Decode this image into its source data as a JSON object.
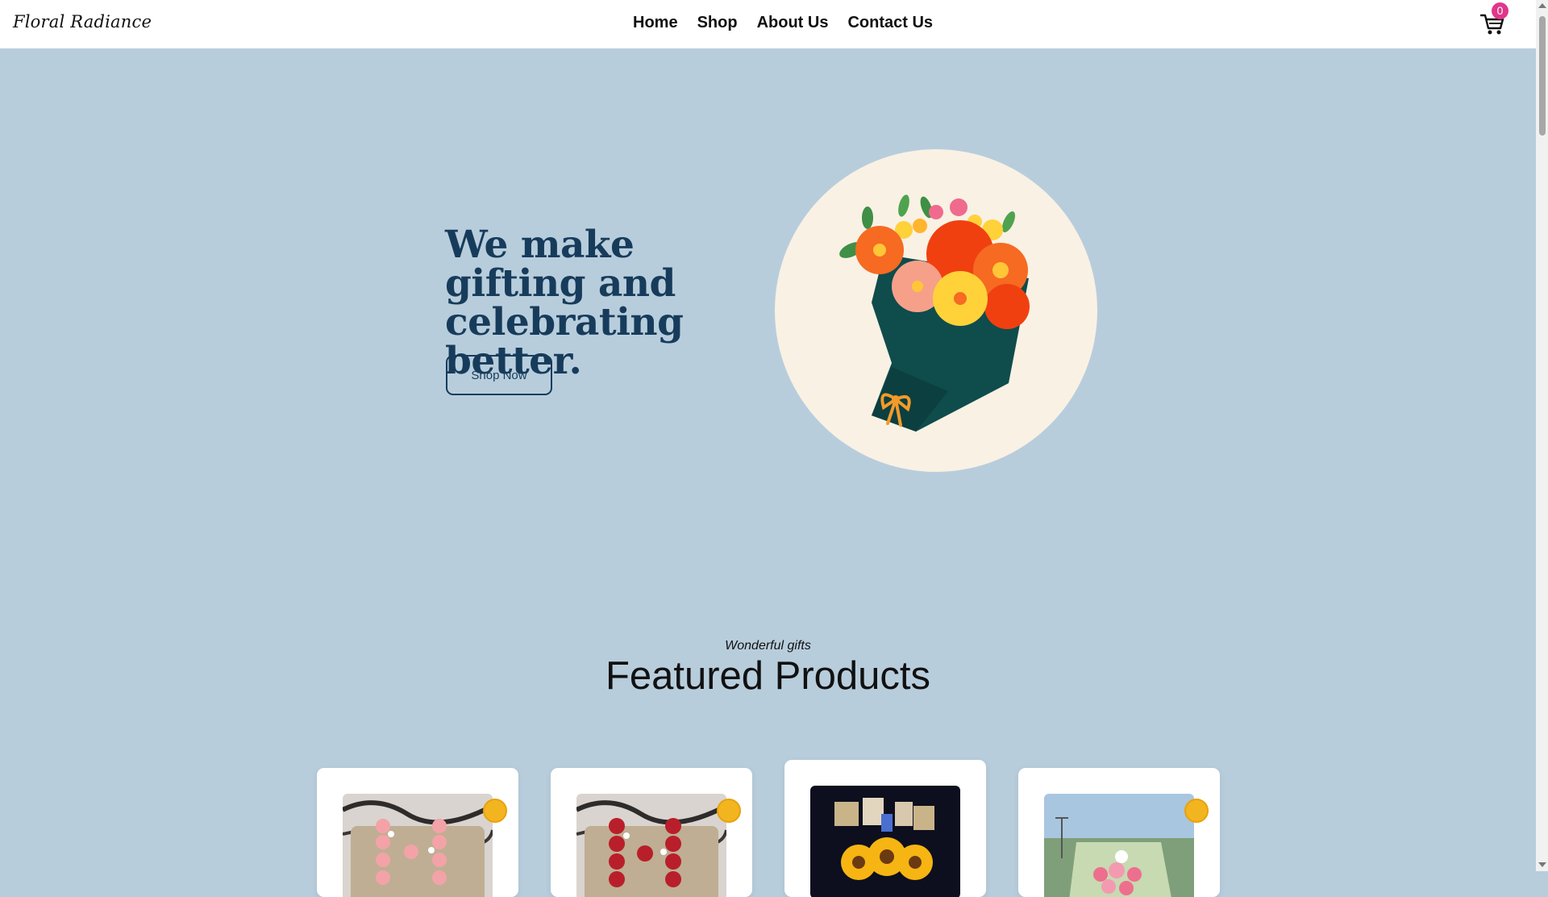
{
  "header": {
    "logo": "Floral Radiance",
    "nav": [
      "Home",
      "Shop",
      "About Us",
      "Contact Us"
    ],
    "cart_count": "0"
  },
  "hero": {
    "title": "We make gifting and celebrating better.",
    "cta_label": "Shop Now"
  },
  "featured": {
    "kicker": "Wonderful gifts",
    "title": "Featured Products",
    "products": [
      {
        "image": "pink-rose-letter-bouquet"
      },
      {
        "image": "red-rose-letter-bouquet"
      },
      {
        "image": "sunflower-chocolate-bouquet"
      },
      {
        "image": "pink-flower-bouquet"
      }
    ]
  },
  "colors": {
    "background": "#b8cddc",
    "heading": "#173c5b",
    "circle": "#f9f1e4",
    "badge": "#e0378a"
  }
}
